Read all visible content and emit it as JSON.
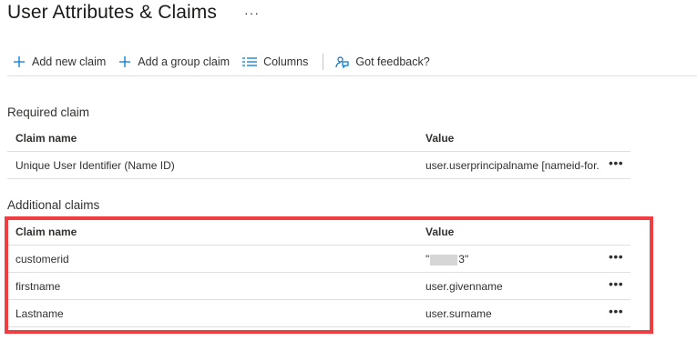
{
  "page": {
    "title": "User Attributes & Claims",
    "more_label": "···"
  },
  "toolbar": {
    "add_new_claim": "Add new claim",
    "add_group_claim": "Add a group claim",
    "columns": "Columns",
    "feedback": "Got feedback?"
  },
  "required": {
    "section_label": "Required claim",
    "headers": {
      "name": "Claim name",
      "value": "Value"
    },
    "rows": [
      {
        "name": "Unique User Identifier (Name ID)",
        "value": "user.userprincipalname [nameid-for...",
        "more": "•••"
      }
    ]
  },
  "additional": {
    "section_label": "Additional claims",
    "headers": {
      "name": "Claim name",
      "value": "Value"
    },
    "rows": [
      {
        "name": "customerid",
        "value_prefix": "\"",
        "value_suffix": "3\"",
        "more": "•••"
      },
      {
        "name": "firstname",
        "value": "user.givenname",
        "more": "•••"
      },
      {
        "name": "Lastname",
        "value": "user.surname",
        "more": "•••"
      }
    ]
  },
  "highlight_color": "#ee3e42",
  "accent_color": "#0078d4"
}
